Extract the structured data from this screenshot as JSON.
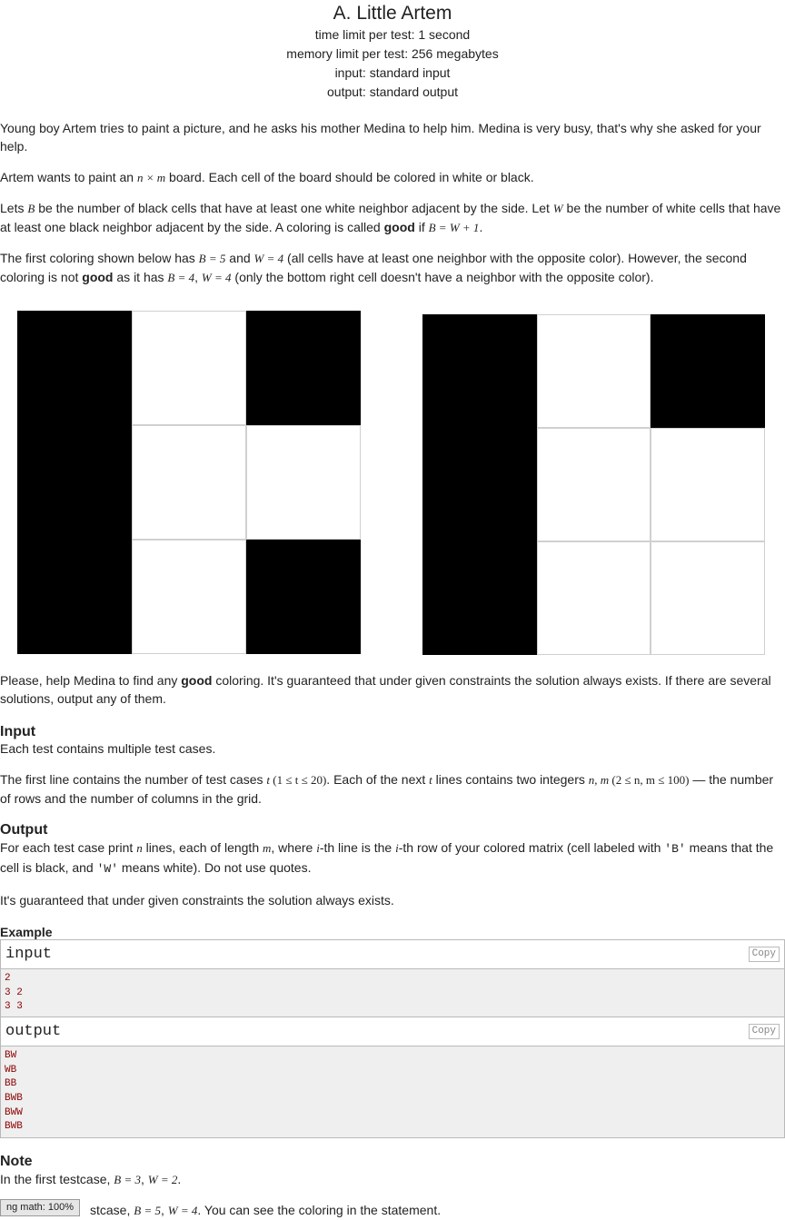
{
  "problem": {
    "title": "A. Little Artem",
    "time_limit": "time limit per test: 1 second",
    "memory_limit": "memory limit per test: 256 megabytes",
    "input_file": "input: standard input",
    "output_file": "output: standard output"
  },
  "statement": {
    "p1": "Young boy Artem tries to paint a picture, and he asks his mother Medina to help him. Medina is very busy, that's why she asked for your help.",
    "p2_a": "Artem wants to paint an ",
    "p2_math": "n × m",
    "p2_b": " board. Each cell of the board should be colored in white or black.",
    "p3_a": "Lets ",
    "p3_B": "B",
    "p3_b": " be the number of black cells that have at least one white neighbor adjacent by the side. Let ",
    "p3_W": "W",
    "p3_c": " be the number of white cells that have at least one black neighbor adjacent by the side. A coloring is called ",
    "p3_good": "good",
    "p3_d": " if ",
    "p3_math": "B = W + 1",
    "p3_e": ".",
    "p4_a": "The first coloring shown below has ",
    "p4_m1": "B = 5",
    "p4_b": " and ",
    "p4_m2": "W = 4",
    "p4_c": " (all cells have at least one neighbor with the opposite color). However, the second coloring is not ",
    "p4_good": "good",
    "p4_d": " as it has ",
    "p4_m3": "B = 4",
    "p4_sep": ", ",
    "p4_m4": "W = 4",
    "p4_e": " (only the bottom right cell doesn't have a neighbor with the opposite color).",
    "p5_a": "Please, help Medina to find any ",
    "p5_good": "good",
    "p5_b": " coloring. It's guaranteed that under given constraints the solution always exists. If there are several solutions, output any of them."
  },
  "figures": [
    {
      "rows": [
        "BWB",
        "BWW",
        "BWB"
      ]
    },
    {
      "rows": [
        "BWB",
        "BWW",
        "BWW"
      ]
    }
  ],
  "input_section": {
    "title": "Input",
    "p1": "Each test contains multiple test cases.",
    "p2_a": "The first line contains the number of test cases ",
    "p2_t": "t",
    "p2_m1": " (1 ≤ t ≤ 20)",
    "p2_b": ". Each of the next ",
    "p2_t2": "t",
    "p2_c": " lines contains two integers ",
    "p2_nm": "n, m",
    "p2_m2": " (2 ≤ n, m ≤ 100)",
    "p2_d": " — the number of rows and the number of columns in the grid."
  },
  "output_section": {
    "title": "Output",
    "p1_a": "For each test case print ",
    "p1_n": "n",
    "p1_b": " lines, each of length ",
    "p1_m": "m",
    "p1_c": ", where ",
    "p1_i": "i",
    "p1_d": "-th line is the ",
    "p1_i2": "i",
    "p1_e": "-th row of your colored matrix (cell labeled with ",
    "p1_B": "'B'",
    "p1_f": " means that the cell is black, and ",
    "p1_W": "'W'",
    "p1_g": " means white). Do not use quotes.",
    "p2": "It's guaranteed that under given constraints the solution always exists."
  },
  "example": {
    "title": "Example",
    "input_label": "input",
    "output_label": "output",
    "copy_label": "Copy",
    "input_lines": [
      "2",
      "3 2",
      "3 3"
    ],
    "output_lines": [
      "BW",
      "WB",
      "BB",
      "BWB",
      "BWW",
      "BWB"
    ]
  },
  "note": {
    "title": "Note",
    "p1_a": "In the first testcase, ",
    "p1_m1": "B = 3",
    "p1_sep": ", ",
    "p1_m2": "W = 2",
    "p1_b": ".",
    "p2_a": "stcase, ",
    "p2_m1": "B = 5",
    "p2_sep": ", ",
    "p2_m2": "W = 4",
    "p2_b": ". You can see the coloring in the statement."
  },
  "status_badge": "ng math: 100%",
  "colors": {
    "text": "#222222",
    "black_cell": "#000000",
    "io_bg": "#efefef",
    "io_text": "#8b0000"
  }
}
